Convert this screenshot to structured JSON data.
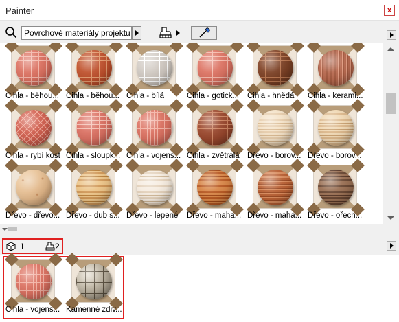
{
  "window": {
    "title": "Painter",
    "close_label": "x"
  },
  "toolbar": {
    "search_value": "Povrchové materiály projektu"
  },
  "materials": [
    {
      "label": "Cihla - běhou...",
      "pattern": "brick",
      "c1": "#e07a6a",
      "c2": "#f2b3a6",
      "accent": "#d66a5a"
    },
    {
      "label": "Cihla - běhou...",
      "pattern": "brick",
      "c1": "#c55a34",
      "c2": "#e29b70",
      "accent": "#b84a28"
    },
    {
      "label": "Cihla - bílá",
      "pattern": "brick",
      "c1": "#d8d2cc",
      "c2": "#ffffff",
      "accent": "#c8c0b8"
    },
    {
      "label": "Cihla - gotick...",
      "pattern": "brick",
      "c1": "#e07a6a",
      "c2": "#f4b8aa",
      "accent": "#d86e5e"
    },
    {
      "label": "Cihla - hnědá",
      "pattern": "brick",
      "c1": "#8a4a2c",
      "c2": "#b87650",
      "accent": "#703a20"
    },
    {
      "label": "Cihla - kerami...",
      "pattern": "vstripe",
      "c1": "#b86a50",
      "c2": "#e09a80",
      "accent": "#a45a40"
    },
    {
      "label": "Cihla - rybí kost",
      "pattern": "herring",
      "c1": "#d86858",
      "c2": "#f0a898",
      "accent": "#c85848"
    },
    {
      "label": "Cihla - sloupk...",
      "pattern": "brick",
      "c1": "#e0786a",
      "c2": "#f4bcaf",
      "accent": "#d46a5c"
    },
    {
      "label": "Cihla - vojens...",
      "pattern": "vbrick",
      "c1": "#e07a6a",
      "c2": "#f2b0a2",
      "accent": "#d66c5c"
    },
    {
      "label": "Cihla - zvětralá",
      "pattern": "brick",
      "c1": "#a45034",
      "c2": "#cc8462",
      "accent": "#8e4028"
    },
    {
      "label": "Dřevo - borov...",
      "pattern": "wood",
      "c1": "#e6ccab",
      "c2": "#f4e2c8",
      "accent": "#d8b890"
    },
    {
      "label": "Dřevo - borov...",
      "pattern": "wood",
      "c1": "#dcb88c",
      "c2": "#f0d8b4",
      "accent": "#c8a070"
    },
    {
      "label": "Dřevo - dřevo...",
      "pattern": "speck",
      "c1": "#d8a878",
      "c2": "#f0d0a8",
      "accent": "#c89060"
    },
    {
      "label": "Dřevo - dub s...",
      "pattern": "wood",
      "c1": "#d09858",
      "c2": "#ecc488",
      "accent": "#b8803c"
    },
    {
      "label": "Dřevo - lepené",
      "pattern": "wood",
      "c1": "#e4d2bc",
      "c2": "#f6ece0",
      "accent": "#d0b898"
    },
    {
      "label": "Dřevo - maha...",
      "pattern": "wood",
      "c1": "#b85a24",
      "c2": "#d88648",
      "accent": "#a04818"
    },
    {
      "label": "Dřevo - maha...",
      "pattern": "plank",
      "c1": "#b86034",
      "c2": "#d88a5c",
      "accent": "#9a4a24"
    },
    {
      "label": "Dřevo - ořech...",
      "pattern": "wood",
      "c1": "#6a4834",
      "c2": "#9a7054",
      "accent": "#583828"
    }
  ],
  "info_bar": {
    "element_count": "1",
    "material_count": "2"
  },
  "used_materials": [
    {
      "label": "Cihla - vojens...",
      "pattern": "vbrick",
      "c1": "#e07a6a",
      "c2": "#f2b0a2",
      "accent": "#d66c5c"
    },
    {
      "label": "Kamenné zdiv...",
      "pattern": "stone",
      "c1": "#8c8270",
      "c2": "#e0d8c8",
      "accent": "#5a5040"
    }
  ]
}
